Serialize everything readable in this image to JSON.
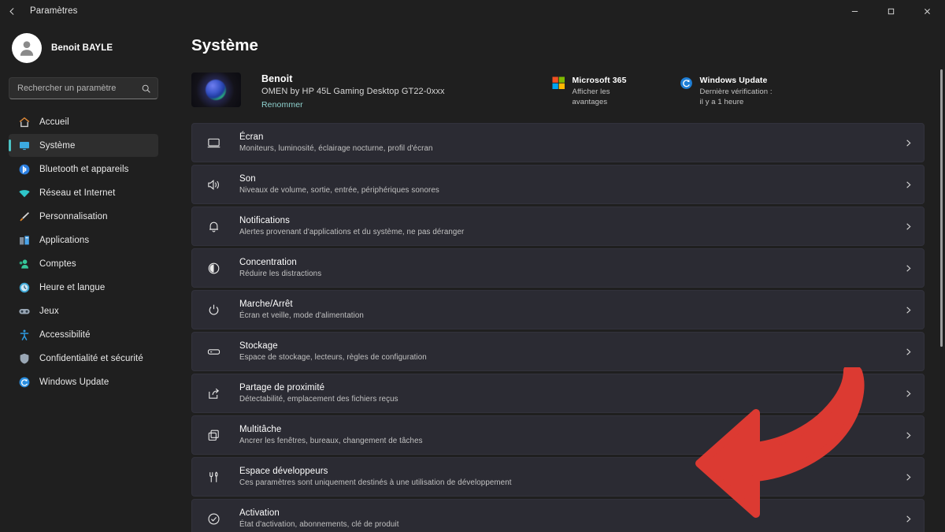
{
  "window": {
    "title": "Paramètres",
    "back_icon": "back-arrow-icon",
    "minimize_label": "Réduire",
    "maximize_label": "Agrandir",
    "close_label": "Fermer"
  },
  "sidebar": {
    "profile": {
      "name": "Benoit BAYLE",
      "avatar_icon": "person-avatar-icon"
    },
    "search": {
      "placeholder": "Rechercher un paramètre",
      "value": "",
      "icon": "search-icon"
    },
    "items": [
      {
        "label": "Accueil",
        "icon": "home-icon",
        "active": false,
        "color": "#e08a38"
      },
      {
        "label": "Système",
        "icon": "monitor-icon",
        "active": true,
        "color": "#3ca9e0"
      },
      {
        "label": "Bluetooth et appareils",
        "icon": "bluetooth-icon",
        "active": false,
        "color": "#2a7ee0"
      },
      {
        "label": "Réseau et Internet",
        "icon": "wifi-icon",
        "active": false,
        "color": "#2fc6c9"
      },
      {
        "label": "Personnalisation",
        "icon": "paintbrush-icon",
        "active": false,
        "color": "#e88a2a"
      },
      {
        "label": "Applications",
        "icon": "apps-icon",
        "active": false,
        "color": "#4aa3e8"
      },
      {
        "label": "Comptes",
        "icon": "accounts-icon",
        "active": false,
        "color": "#36c79a"
      },
      {
        "label": "Heure et langue",
        "icon": "clock-icon",
        "active": false,
        "color": "#3fa8d6"
      },
      {
        "label": "Jeux",
        "icon": "gamepad-icon",
        "active": false,
        "color": "#9aa7b5"
      },
      {
        "label": "Accessibilité",
        "icon": "accessibility-icon",
        "active": false,
        "color": "#2f9ae0"
      },
      {
        "label": "Confidentialité et sécurité",
        "icon": "shield-icon",
        "active": false,
        "color": "#9aa7b5"
      },
      {
        "label": "Windows Update",
        "icon": "update-icon",
        "active": false,
        "color": "#2a8ee0"
      }
    ],
    "active_indicator_color": "#4cc2c4"
  },
  "main": {
    "page_title": "Système",
    "device": {
      "name": "Benoit",
      "model": "OMEN by HP 45L Gaming Desktop GT22-0xxx",
      "rename_label": "Renommer",
      "thumbnail_icon": "desktop-wallpaper-thumbnail"
    },
    "quick_tiles": [
      {
        "title": "Microsoft 365",
        "subtitle": "Afficher les avantages",
        "icon": "microsoft-logo-icon"
      },
      {
        "title": "Windows Update",
        "subtitle": "Dernière vérification : il y a 1 heure",
        "icon": "update-refresh-icon"
      }
    ],
    "settings_rows": [
      {
        "title": "Écran",
        "subtitle": "Moniteurs, luminosité, éclairage nocturne, profil d'écran",
        "icon": "monitor-icon"
      },
      {
        "title": "Son",
        "subtitle": "Niveaux de volume, sortie, entrée, périphériques sonores",
        "icon": "speaker-icon"
      },
      {
        "title": "Notifications",
        "subtitle": "Alertes provenant d'applications et du système, ne pas déranger",
        "icon": "bell-icon"
      },
      {
        "title": "Concentration",
        "subtitle": "Réduire les distractions",
        "icon": "focus-icon"
      },
      {
        "title": "Marche/Arrêt",
        "subtitle": "Écran et veille, mode d'alimentation",
        "icon": "power-icon"
      },
      {
        "title": "Stockage",
        "subtitle": "Espace de stockage, lecteurs, règles de configuration",
        "icon": "storage-icon"
      },
      {
        "title": "Partage de proximité",
        "subtitle": "Détectabilité, emplacement des fichiers reçus",
        "icon": "share-icon"
      },
      {
        "title": "Multitâche",
        "subtitle": "Ancrer les fenêtres, bureaux, changement de tâches",
        "icon": "multitask-icon"
      },
      {
        "title": "Espace développeurs",
        "subtitle": "Ces paramètres sont uniquement destinés à une utilisation de développement",
        "icon": "developer-tools-icon"
      },
      {
        "title": "Activation",
        "subtitle": "État d'activation, abonnements, clé de produit",
        "icon": "activation-check-icon"
      }
    ],
    "chevron_icon": "chevron-right-icon"
  },
  "annotation": {
    "icon": "curved-left-arrow-annotation",
    "color": "#dc3a32"
  },
  "theme": {
    "page_background": "#1f1f1f",
    "row_background": "#2b2b33",
    "accent": "#4cc2c4",
    "link": "#8fd3d0"
  }
}
